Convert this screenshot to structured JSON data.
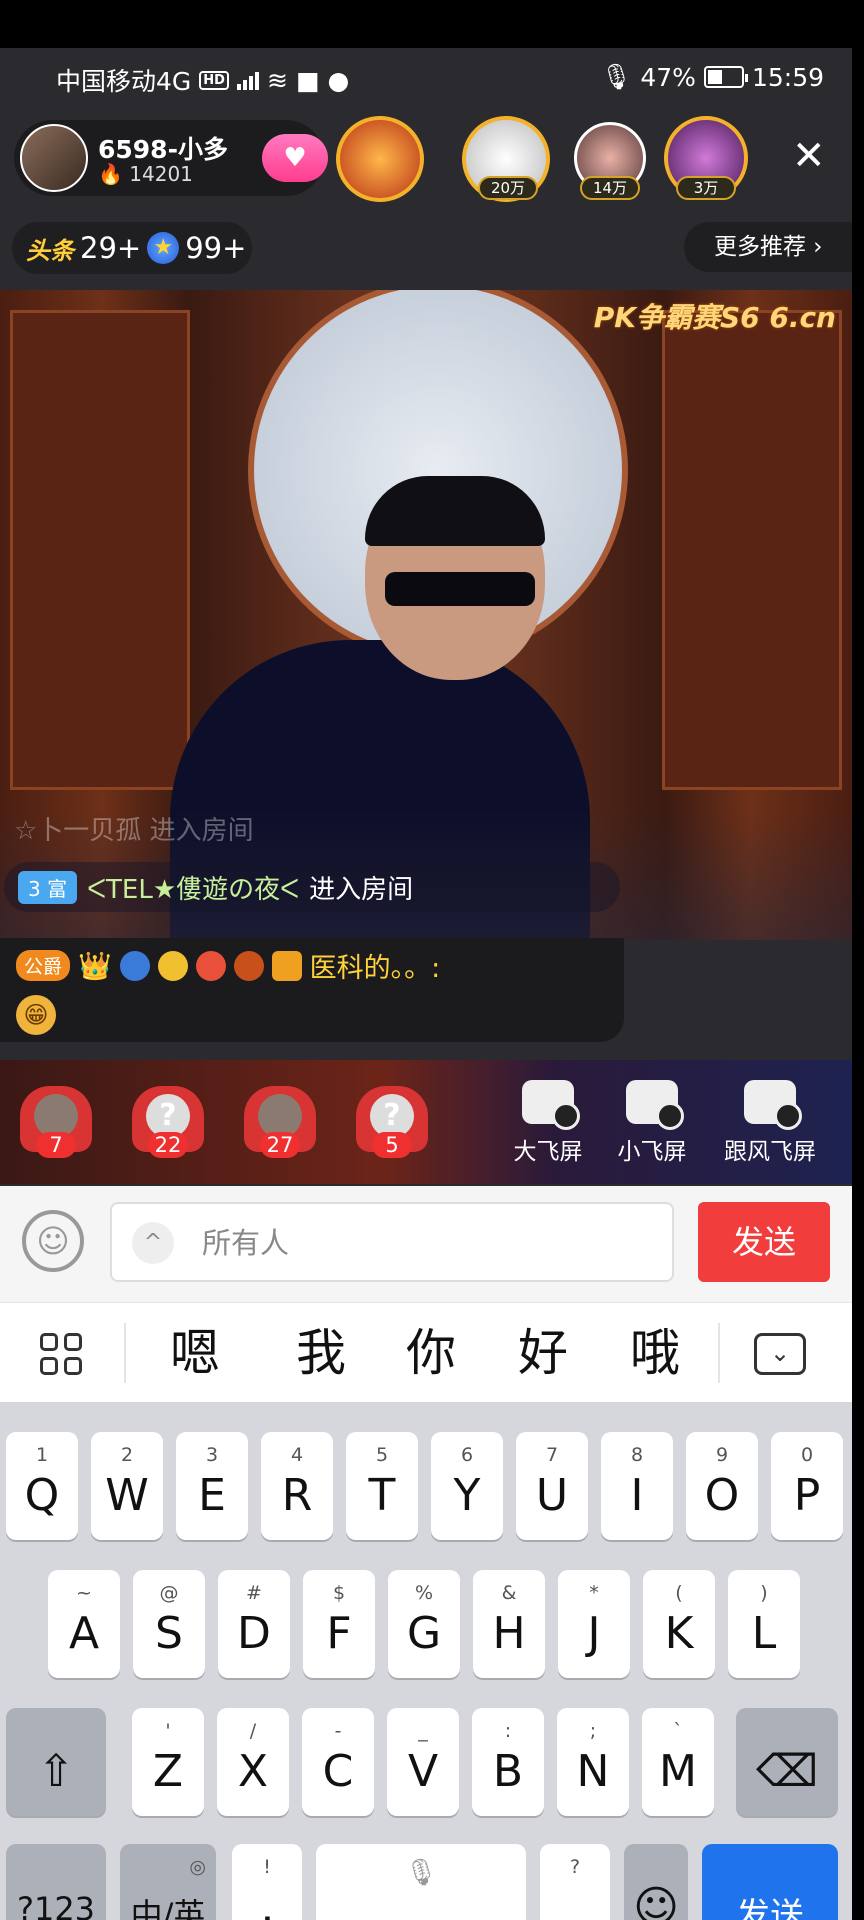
{
  "status_bar": {
    "carrier": "中国移动4G",
    "hd": "HD",
    "net": "4G",
    "battery": "47%",
    "time": "15:59"
  },
  "header": {
    "anchor_name": "6598-小多",
    "anchor_fans": "14201",
    "rank_badges": [
      "20万",
      "14万",
      "3万"
    ],
    "close_label": "✕"
  },
  "toutiao": {
    "label": "头条",
    "count1": "29+",
    "count2": "99+"
  },
  "more_recommend": "更多推荐 ›",
  "video": {
    "watermark": "PK争霸赛S6 6.cn"
  },
  "chat": {
    "ghost_text": "☆卜一贝孤 进入房间",
    "enter": {
      "badge": "3 富",
      "user": "ᐸTEL★僂遊の夜ᐸ",
      "text": "进入房间"
    },
    "message": {
      "title_badge": "公爵",
      "text": "医科的。。:"
    }
  },
  "gifts": [
    {
      "count": "7"
    },
    {
      "count": "22"
    },
    {
      "count": "27"
    },
    {
      "count": "5"
    }
  ],
  "fly_screens": [
    "大飞屏",
    "小飞屏",
    "跟风飞屏"
  ],
  "input": {
    "placeholder": "所有人",
    "send": "发送"
  },
  "candidates": [
    "嗯",
    "我",
    "你",
    "好",
    "哦"
  ],
  "keyboard": {
    "row1": [
      {
        "k": "Q",
        "s": "1"
      },
      {
        "k": "W",
        "s": "2"
      },
      {
        "k": "E",
        "s": "3"
      },
      {
        "k": "R",
        "s": "4"
      },
      {
        "k": "T",
        "s": "5"
      },
      {
        "k": "Y",
        "s": "6"
      },
      {
        "k": "U",
        "s": "7"
      },
      {
        "k": "I",
        "s": "8"
      },
      {
        "k": "O",
        "s": "9"
      },
      {
        "k": "P",
        "s": "0"
      }
    ],
    "row2": [
      {
        "k": "A",
        "s": "~"
      },
      {
        "k": "S",
        "s": "@"
      },
      {
        "k": "D",
        "s": "#"
      },
      {
        "k": "F",
        "s": "$"
      },
      {
        "k": "G",
        "s": "%"
      },
      {
        "k": "H",
        "s": "&"
      },
      {
        "k": "J",
        "s": "*"
      },
      {
        "k": "K",
        "s": "("
      },
      {
        "k": "L",
        "s": ")"
      }
    ],
    "row3": [
      {
        "k": "Z",
        "s": "'"
      },
      {
        "k": "X",
        "s": "/"
      },
      {
        "k": "C",
        "s": "-"
      },
      {
        "k": "V",
        "s": "_"
      },
      {
        "k": "B",
        "s": ":"
      },
      {
        "k": "N",
        "s": ";"
      },
      {
        "k": "M",
        "s": "`"
      }
    ],
    "sym": "?123",
    "lang": "中/英",
    "comma": ",",
    "comma_sub": "!",
    "period": "。",
    "period_sub": "?",
    "send": "发送"
  }
}
